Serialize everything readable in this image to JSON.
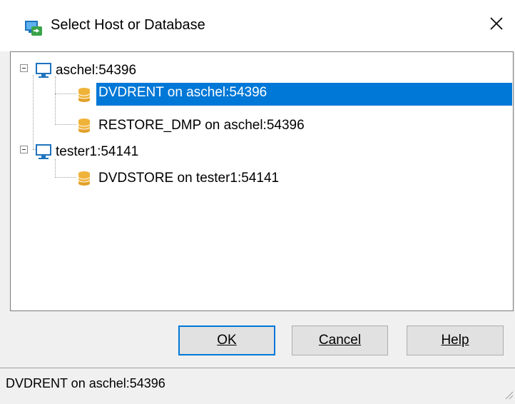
{
  "window": {
    "title": "Select Host or Database",
    "close_glyph": "✕"
  },
  "tree": {
    "hosts": [
      {
        "label": "aschel:54396",
        "databases": [
          {
            "label": "DVDRENT on aschel:54396",
            "selected": true
          },
          {
            "label": "RESTORE_DMP on aschel:54396",
            "selected": false
          }
        ]
      },
      {
        "label": "tester1:54141",
        "databases": [
          {
            "label": "DVDSTORE on tester1:54141",
            "selected": false
          }
        ]
      }
    ]
  },
  "buttons": {
    "ok_label": "OK",
    "cancel_label": "Cancel",
    "help_label": "Help"
  },
  "status": {
    "text": "DVDRENT on aschel:54396"
  },
  "colors": {
    "selection": "#0078d7",
    "database_icon": "#f0b33a",
    "monitor_icon": "#1e73be"
  },
  "icons": {
    "app": "select-host-app-icon",
    "host": "monitor-icon",
    "database": "database-icon",
    "expander": "collapse-minus-icon",
    "close": "close-icon"
  }
}
